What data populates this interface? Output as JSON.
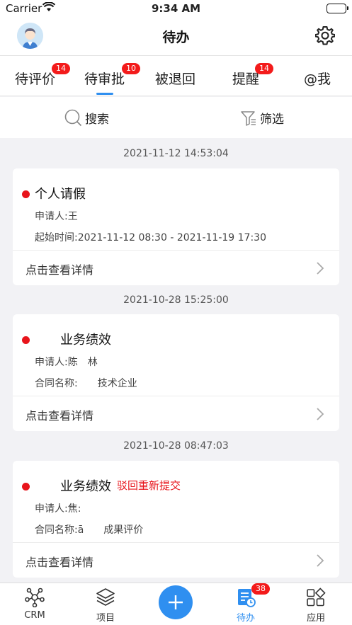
{
  "status": {
    "carrier": "Carrier",
    "time": "9:34 AM"
  },
  "header": {
    "title": "待办"
  },
  "tabs": [
    {
      "label": "待评价",
      "badge": "14"
    },
    {
      "label": "待审批",
      "badge": "10",
      "active": true
    },
    {
      "label": "被退回",
      "badge": ""
    },
    {
      "label": "提醒",
      "badge": "14"
    },
    {
      "label": "@我",
      "badge": ""
    }
  ],
  "search": {
    "search_label": "搜索",
    "filter_label": "筛选"
  },
  "items": [
    {
      "date": "2021-11-12 14:53:04",
      "title": "个人请假",
      "tag": "",
      "line1": "申请人:王",
      "line2": "起始时间:2021-11-12 08:30 - 2021-11-19 17:30",
      "detail": "点击查看详情"
    },
    {
      "date": "2021-10-28 15:25:00",
      "title": "业务绩效",
      "tag": "",
      "line1": "申请人:陈　林",
      "line2": "合同名称:　　技术企业",
      "detail": "点击查看详情"
    },
    {
      "date": "2021-10-28 08:47:03",
      "title": "业务绩效",
      "tag": "驳回重新提交",
      "line1": "申请人:焦:",
      "line2": "合同名称:ā　　成果评价",
      "detail": "点击查看详情"
    }
  ],
  "bottom_nav": [
    {
      "label": "CRM",
      "icon": "network-icon"
    },
    {
      "label": "项目",
      "icon": "layers-icon"
    },
    {
      "label": "",
      "icon": "plus-icon"
    },
    {
      "label": "待办",
      "icon": "todo-icon",
      "badge": "38",
      "active": true
    },
    {
      "label": "应用",
      "icon": "apps-icon"
    }
  ],
  "colors": {
    "accent": "#2f8ff0",
    "badge": "#f31b1b",
    "dot": "#e8141b"
  }
}
